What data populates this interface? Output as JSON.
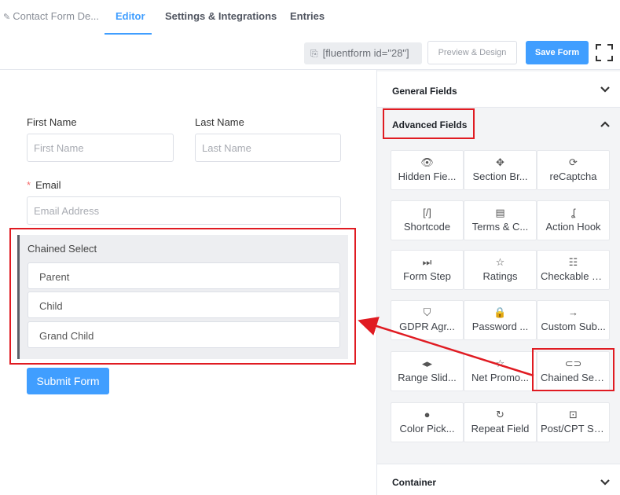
{
  "nav": {
    "form_name": "Contact Form De...",
    "tabs": [
      "Editor",
      "Settings & Integrations",
      "Entries"
    ]
  },
  "toolbar": {
    "shortcode": "[fluentform id=\"28\"]",
    "preview_label": "Preview & Design",
    "save_label": "Save Form"
  },
  "form": {
    "first_name_label": "First Name",
    "first_name_placeholder": "First Name",
    "last_name_label": "Last Name",
    "last_name_placeholder": "Last Name",
    "email_required_mark": "*",
    "email_label": "Email",
    "email_placeholder": "Email Address",
    "chained_label": "Chained Select",
    "chained_options": [
      "Parent",
      "Child",
      "Grand Child"
    ],
    "submit_label": "Submit Form"
  },
  "panel": {
    "general_title": "General Fields",
    "advanced_title": "Advanced Fields",
    "container_title": "Container",
    "fields": [
      {
        "label": "Hidden Fie...",
        "icon": "eye-slash-icon",
        "glyph": "👁"
      },
      {
        "label": "Section Br...",
        "icon": "puzzle-icon",
        "glyph": "✥"
      },
      {
        "label": "reCaptcha",
        "icon": "recaptcha-icon",
        "glyph": "⟳"
      },
      {
        "label": "Shortcode",
        "icon": "shortcode-icon",
        "glyph": "[/]"
      },
      {
        "label": "Terms & C...",
        "icon": "scroll-icon",
        "glyph": "▤"
      },
      {
        "label": "Action Hook",
        "icon": "hook-icon",
        "glyph": "ʆ"
      },
      {
        "label": "Form Step",
        "icon": "step-forward-icon",
        "glyph": "⏭"
      },
      {
        "label": "Ratings",
        "icon": "star-icon",
        "glyph": "☆"
      },
      {
        "label": "Checkable Gr...",
        "icon": "checkable-grid-icon",
        "glyph": "☷"
      },
      {
        "label": "GDPR Agr...",
        "icon": "shield-icon",
        "glyph": "⛉"
      },
      {
        "label": "Password ...",
        "icon": "lock-icon",
        "glyph": "🔒"
      },
      {
        "label": "Custom Sub...",
        "icon": "arrow-right-icon",
        "glyph": "→"
      },
      {
        "label": "Range Slid...",
        "icon": "range-slider-icon",
        "glyph": "◂▸"
      },
      {
        "label": "Net Promo...",
        "icon": "net-promoter-icon",
        "glyph": "☆"
      },
      {
        "label": "Chained Sele...",
        "icon": "chain-link-icon",
        "glyph": "⊂⊃"
      },
      {
        "label": "Color Pick...",
        "icon": "color-drop-icon",
        "glyph": "●"
      },
      {
        "label": "Repeat Field",
        "icon": "repeat-icon",
        "glyph": "↻"
      },
      {
        "label": "Post/CPT Sel...",
        "icon": "post-select-icon",
        "glyph": "⊡"
      }
    ]
  },
  "colors": {
    "accent": "#409eff",
    "annotation_red": "#e01b22"
  }
}
